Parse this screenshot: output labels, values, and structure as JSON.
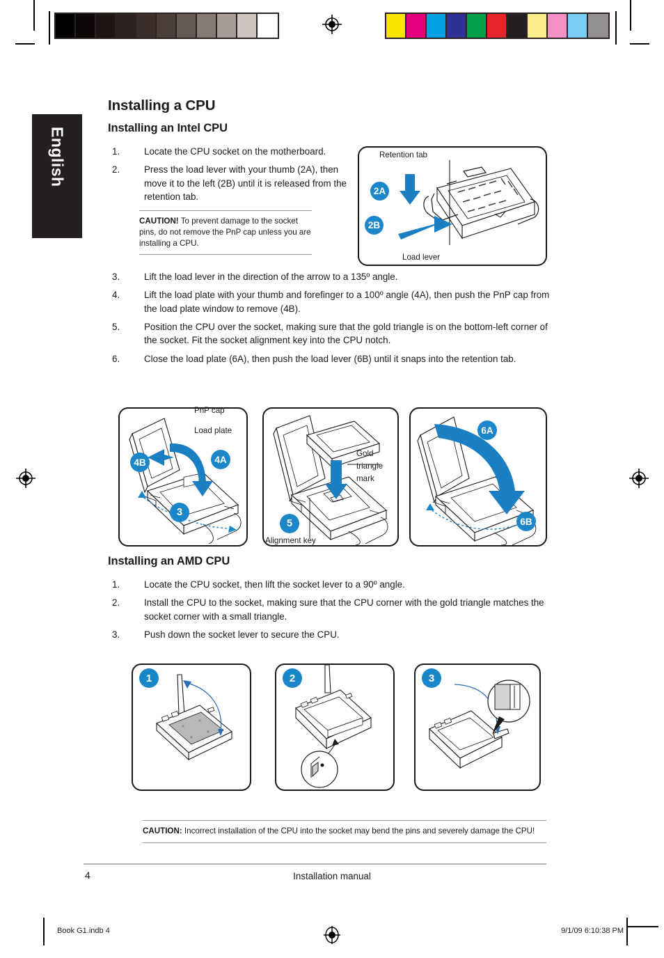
{
  "language_tab": {
    "label": "English"
  },
  "document": {
    "title": "Installing a CPU",
    "intel": {
      "heading": "Installing an Intel CPU",
      "steps": [
        {
          "num": "1.",
          "text": "Locate the CPU socket on the motherboard."
        },
        {
          "num": "2.",
          "text": "Press the load lever with your thumb (2A), then move it to the left (2B) until it is released from the retention tab."
        },
        {
          "num": "3.",
          "text": "Lift the load lever in the direction of the arrow to a 135º angle."
        },
        {
          "num": "4.",
          "text": "Lift the load plate with your thumb and forefinger to a 100º angle (4A), then push the PnP cap from the load plate window to remove (4B)."
        },
        {
          "num": "5.",
          "text": "Position the CPU over the socket, making sure that the gold triangle is on the bottom-left corner of the socket. Fit the socket alignment key into the CPU notch."
        },
        {
          "num": "6.",
          "text": "Close the load plate (6A), then push the load lever (6B) until it snaps into the retention tab."
        }
      ],
      "caution": {
        "label": "CAUTION!",
        "text": " To prevent damage to the socket pins, do not remove the PnP cap unless you are installing a CPU."
      }
    },
    "amd": {
      "heading": "Installing an AMD CPU",
      "steps": [
        {
          "num": "1.",
          "text": "Locate the CPU socket, then lift the socket lever to a 90º angle."
        },
        {
          "num": "2.",
          "text": "Install the CPU to the socket, making sure that the CPU corner with the gold triangle matches the socket corner with a small triangle."
        },
        {
          "num": "3.",
          "text": "Push down the socket lever to secure the CPU."
        }
      ],
      "caution": {
        "label": "CAUTION:",
        "text": " Incorrect installation of the CPU into the socket may bend the pins and severely damage the CPU!"
      }
    }
  },
  "figures": {
    "socket_top": {
      "retention_tab": "Retention tab",
      "load_lever": "Load lever",
      "marker_a": "2A",
      "marker_b": "2B"
    },
    "step4": {
      "pnp_cap": "PnP cap",
      "load_plate": "Load plate",
      "marker_4b": "4B",
      "marker_4a": "4A",
      "marker_3": "3"
    },
    "step5": {
      "gold_line1": "Gold",
      "gold_line2": "triangle",
      "gold_line3": "mark",
      "alignment_key": "Alignment key",
      "marker_5": "5"
    },
    "step6": {
      "marker_6a": "6A",
      "marker_6b": "6B"
    },
    "amd1": {
      "marker": "1"
    },
    "amd2": {
      "marker": "2"
    },
    "amd3": {
      "marker": "3"
    }
  },
  "footer": {
    "page_number": "4",
    "center_text": "Installation manual",
    "imprint_left": "Book G1.indb   4",
    "imprint_right": "9/1/09   6:10:38 PM"
  },
  "colors": {
    "accent_blue": "#1b86c8",
    "marker_blue": "#1b86c8",
    "tab_black": "#231f20",
    "text": "#1a1a1a",
    "rule_gray": "#9a9a9a"
  },
  "calibration": {
    "grayscale_bar": [
      "#000000",
      "#0d0807",
      "#1d1614",
      "#2a201e",
      "#3a2d29",
      "#4c3f3a",
      "#665a54",
      "#867a74",
      "#a79c98",
      "#cfc6c2",
      "#ffffff"
    ],
    "color_bar": [
      "#fbe500",
      "#e5007e",
      "#00a0e2",
      "#2e3192",
      "#00a04a",
      "#e8232a",
      "#231f20",
      "#fbee8a",
      "#f391c4",
      "#79cdf2",
      "#918f90"
    ]
  }
}
